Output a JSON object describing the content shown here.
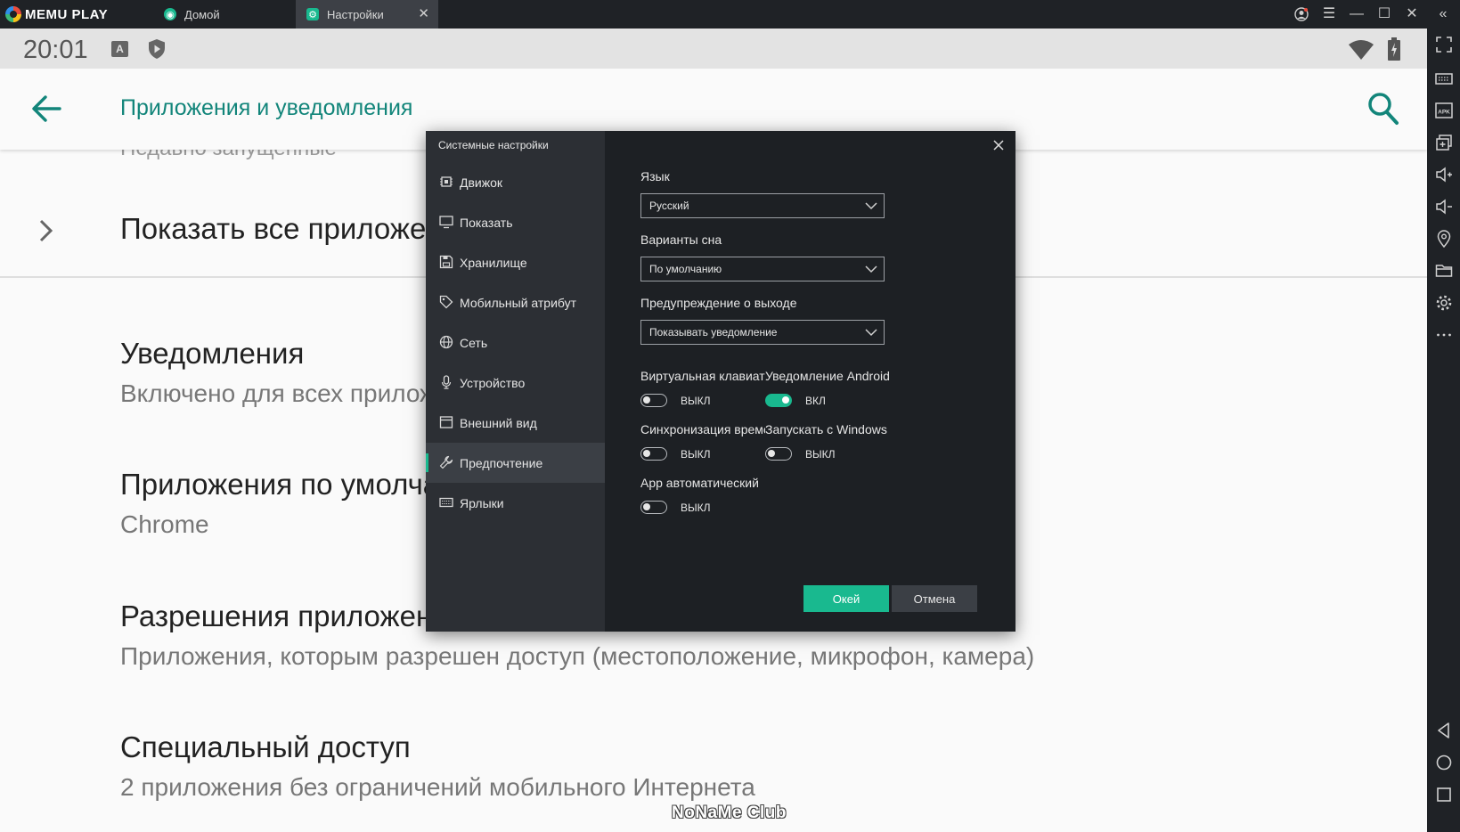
{
  "window": {
    "brand": "MEMU PLAY",
    "tabs": [
      {
        "label": "Домой",
        "icon": "home-tab-icon"
      },
      {
        "label": "Настройки",
        "icon": "settings-tab-icon",
        "active": true
      }
    ],
    "close_glyph": "✕"
  },
  "statusbar": {
    "time": "20:01",
    "notif_letter": "A"
  },
  "appbar": {
    "title": "Приложения и уведомления"
  },
  "list": {
    "peek_text": "Недавно запущенные",
    "show_all": "Показать все приложения",
    "items": [
      {
        "title": "Уведомления",
        "subtitle": "Включено для всех приложений"
      },
      {
        "title": "Приложения по умолчанию",
        "subtitle": "Chrome"
      },
      {
        "title": "Разрешения приложений",
        "subtitle": "Приложения, которым разрешен доступ (местоположение, микрофон, камера)"
      },
      {
        "title": "Специальный доступ",
        "subtitle": "2 приложения без ограничений мобильного Интернета"
      }
    ]
  },
  "dialog": {
    "title": "Системные настройки",
    "nav": [
      {
        "label": "Движок",
        "icon": "chip-icon"
      },
      {
        "label": "Показать",
        "icon": "monitor-icon"
      },
      {
        "label": "Хранилище",
        "icon": "floppy-icon"
      },
      {
        "label": "Мобильный атрибут",
        "icon": "tag-icon"
      },
      {
        "label": "Сеть",
        "icon": "globe-icon"
      },
      {
        "label": "Устройство",
        "icon": "microphone-icon"
      },
      {
        "label": "Внешний вид",
        "icon": "window-icon"
      },
      {
        "label": "Предпочтение",
        "icon": "wrench-icon",
        "active": true
      },
      {
        "label": "Ярлыки",
        "icon": "keyboard-icon"
      }
    ],
    "fields": {
      "language": {
        "label": "Язык",
        "value": "Русский"
      },
      "sleep": {
        "label": "Варианты сна",
        "value": "По умолчанию"
      },
      "exit_warning": {
        "label": "Предупреждение о выходе",
        "value": "Показывать уведомление"
      }
    },
    "toggles": {
      "virtual_keyboard": {
        "label": "Виртуальная клавиатура",
        "state": "ВЫКЛ",
        "on": false
      },
      "android_notification": {
        "label": "Уведомление Android",
        "state": "ВКЛ",
        "on": true
      },
      "time_sync": {
        "label": "Синхронизация времени",
        "state": "ВЫКЛ",
        "on": false
      },
      "run_with_windows": {
        "label": "Запускать с Windows",
        "state": "ВЫКЛ",
        "on": false
      },
      "app_auto": {
        "label": "App автоматический",
        "state": "ВЫКЛ",
        "on": false
      }
    },
    "ok_label": "Окей",
    "cancel_label": "Отмена"
  },
  "watermark": "NoNaMe Club",
  "colors": {
    "accent": "#19b98f",
    "android_accent": "#12857a",
    "dialog_bg": "#1d2024",
    "dialog_sidebar": "#2c2f34"
  }
}
